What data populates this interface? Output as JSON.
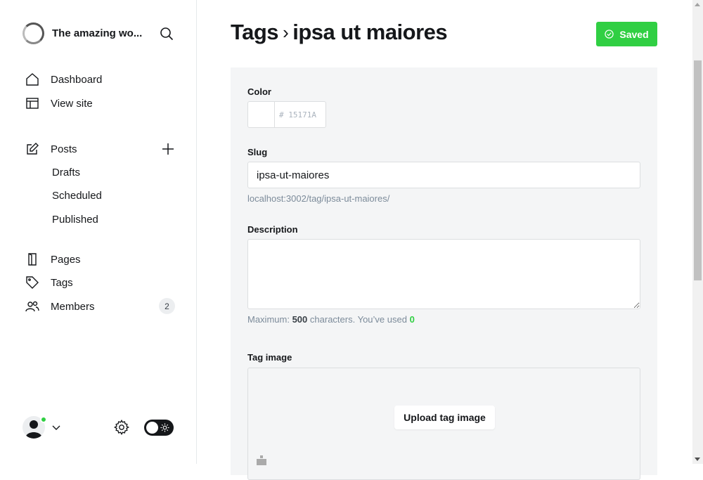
{
  "sidebar": {
    "site_title": "The amazing wo...",
    "nav": {
      "dashboard": "Dashboard",
      "view_site": "View site",
      "posts": "Posts",
      "drafts": "Drafts",
      "scheduled": "Scheduled",
      "published": "Published",
      "pages": "Pages",
      "tags": "Tags",
      "members": "Members",
      "members_count": "2"
    },
    "user_status_color": "#30cf43",
    "toggle_mode": "light"
  },
  "header": {
    "breadcrumb_parent": "Tags",
    "breadcrumb_separator": "›",
    "breadcrumb_current": "ipsa ut maiores",
    "saved_label": "Saved"
  },
  "form": {
    "color_label": "Color",
    "color_value": "# 15171A",
    "slug_label": "Slug",
    "slug_value": "ipsa-ut-maiores",
    "slug_url": "localhost:3002/tag/ipsa-ut-maiores/",
    "description_label": "Description",
    "description_value": "",
    "desc_hint_prefix": "Maximum:",
    "desc_max": "500",
    "desc_hint_mid": "characters. You’ve used",
    "desc_used": "0",
    "tag_image_label": "Tag image",
    "upload_label": "Upload tag image"
  },
  "colors": {
    "accent": "#30cf43",
    "text": "#15171a",
    "panel": "#f4f5f6"
  }
}
